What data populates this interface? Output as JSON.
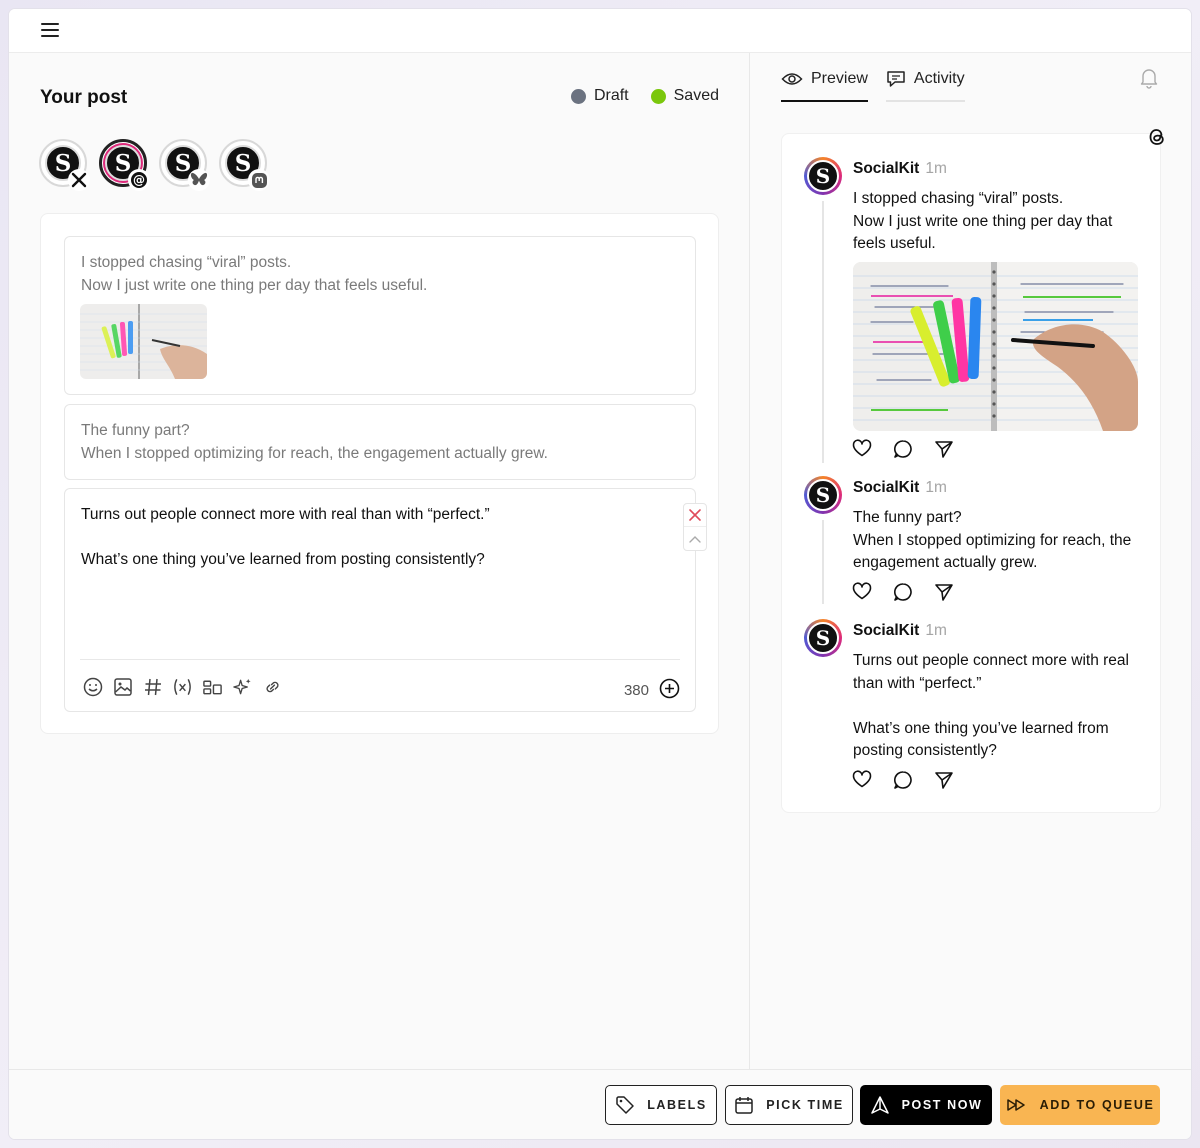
{
  "editor": {
    "title": "Your post",
    "status": [
      {
        "label": "Draft",
        "color": "#6b7280"
      },
      {
        "label": "Saved",
        "color": "#7ac70c"
      }
    ],
    "accounts": [
      {
        "initial": "S",
        "platform": "x-icon"
      },
      {
        "initial": "S",
        "platform": "threads-icon",
        "active": true
      },
      {
        "initial": "S",
        "platform": "bluesky-icon"
      },
      {
        "initial": "S",
        "platform": "mastodon-icon"
      }
    ],
    "segments": [
      {
        "lines": [
          "I stopped chasing “viral” posts.",
          "Now I just write one thing per day that feels useful."
        ],
        "has_image": true
      },
      {
        "lines": [
          "The funny part?",
          "When I stopped optimizing for reach, the engagement actually grew."
        ]
      },
      {
        "lines": [
          "Turns out people connect more with real than with “perfect.”",
          "",
          "What’s one thing you’ve learned from posting consistently?"
        ]
      }
    ],
    "toolbar": {
      "tools": [
        "emoji-icon",
        "image-icon",
        "hashtag-icon",
        "variable-icon",
        "layout-icon",
        "sparkle-icon",
        "link-icon"
      ],
      "char_count": "380"
    }
  },
  "preview": {
    "tabs": [
      {
        "label": "Preview",
        "icon": "eye-icon",
        "active": true
      },
      {
        "label": "Activity",
        "icon": "chat-icon",
        "active": false
      }
    ],
    "posts": [
      {
        "name": "SocialKit",
        "time": "1m",
        "lines": [
          "I stopped chasing “viral” posts.",
          "Now I just write one thing per day that feels useful."
        ]
      },
      {
        "name": "SocialKit",
        "time": "1m",
        "lines": [
          "The funny part?",
          "When I stopped optimizing for reach, the engagement actually grew."
        ]
      },
      {
        "name": "SocialKit",
        "time": "1m",
        "lines": [
          "Turns out people connect more with real than with “perfect.”",
          "",
          "What’s one thing you’ve learned from posting consistently?"
        ]
      }
    ]
  },
  "footer": {
    "labels": "LABELS",
    "pick_time": "PICK TIME",
    "post_now": "POST NOW",
    "add_to_queue": "ADD TO QUEUE"
  },
  "colors": {
    "accent_orange": "#f9b552",
    "draft_dot": "#6b7280",
    "saved_dot": "#7ac70c"
  }
}
